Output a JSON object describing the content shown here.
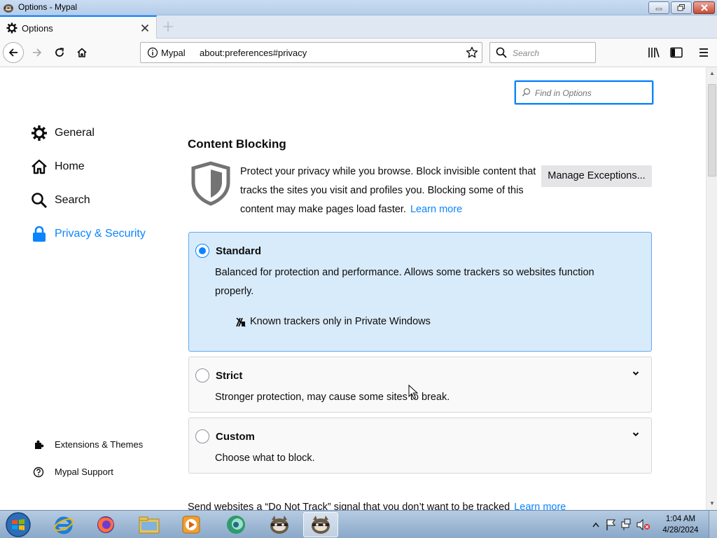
{
  "window": {
    "title": "Options - Mypal"
  },
  "tab": {
    "label": "Options"
  },
  "nav": {
    "identity_label": "Mypal",
    "url": "about:preferences#privacy",
    "search_placeholder": "Search"
  },
  "find": {
    "placeholder": "Find in Options"
  },
  "sidebar": {
    "categories": [
      {
        "label": "General",
        "icon": "gear-icon"
      },
      {
        "label": "Home",
        "icon": "home-icon"
      },
      {
        "label": "Search",
        "icon": "search-icon"
      },
      {
        "label": "Privacy & Security",
        "icon": "lock-icon",
        "active": true
      }
    ],
    "footer": [
      {
        "label": "Extensions & Themes",
        "icon": "puzzle-icon"
      },
      {
        "label": "Mypal Support",
        "icon": "help-icon"
      }
    ]
  },
  "content_blocking": {
    "title": "Content Blocking",
    "description": "Protect your privacy while you browse. Block invisible content that tracks the sites you visit and profiles you. Blocking some of this content may make pages load faster.",
    "learn_more": "Learn more",
    "manage_exceptions": "Manage Exceptions...",
    "options": [
      {
        "title": "Standard",
        "description": "Balanced for protection and performance. Allows some trackers so websites function properly.",
        "detail": "Known trackers only in Private Windows",
        "selected": true
      },
      {
        "title": "Strict",
        "description": "Stronger protection, may cause some sites to break.",
        "selected": false
      },
      {
        "title": "Custom",
        "description": "Choose what to block.",
        "selected": false
      }
    ]
  },
  "dnt": {
    "text": "Send websites a “Do Not Track” signal that you don’t want to be tracked",
    "learn_more": "Learn more"
  },
  "taskbar": {
    "time": "1:04 AM",
    "date": "4/28/2024",
    "apps": [
      "internet-explorer-icon",
      "firefox-icon",
      "file-explorer-icon",
      "media-player-icon",
      "chat-icon",
      "mypal-icon",
      "mypal-icon"
    ]
  },
  "colors": {
    "accent": "#0a84ff",
    "selected_bg": "#d8ebfa"
  }
}
